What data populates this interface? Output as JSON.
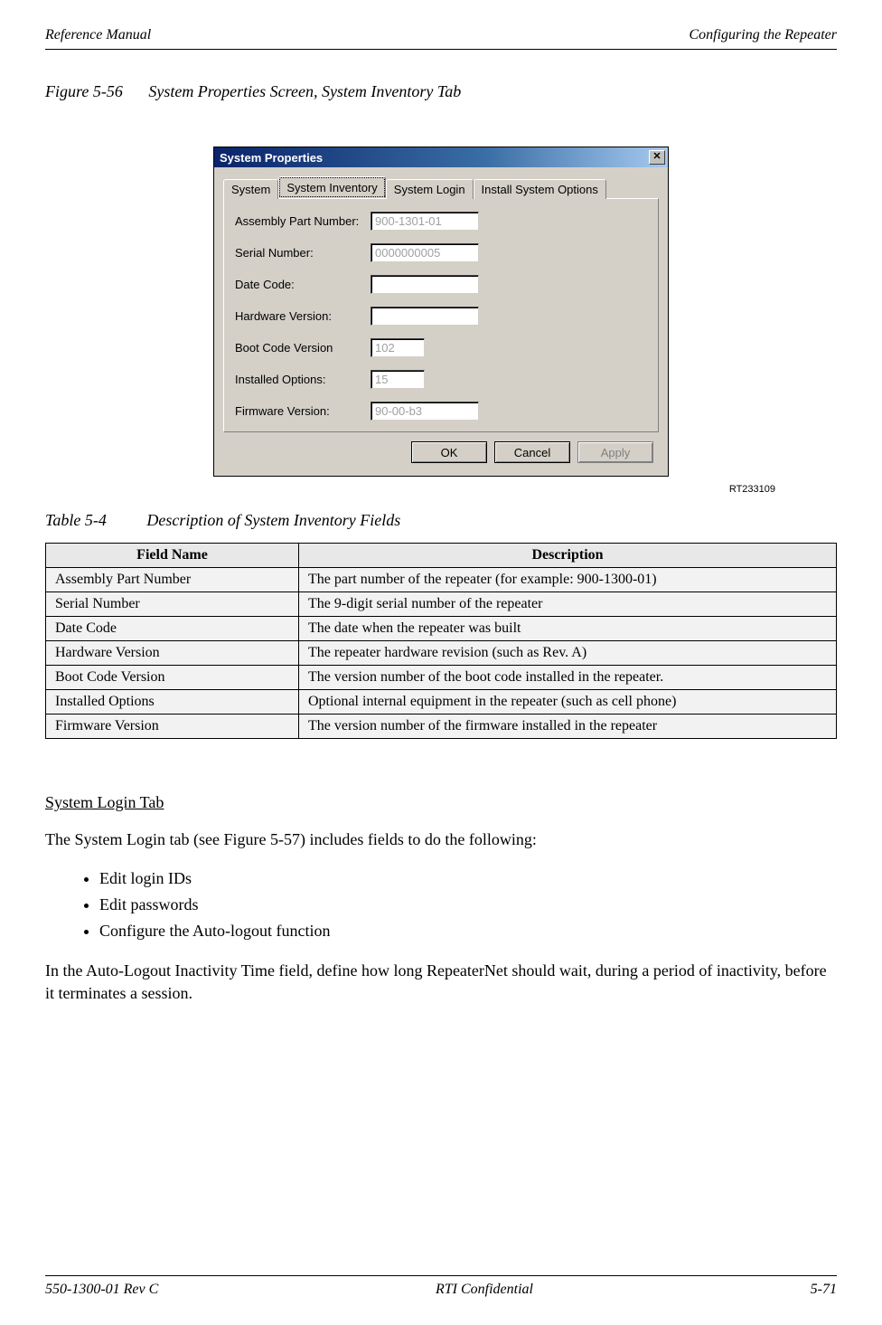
{
  "header": {
    "left": "Reference Manual",
    "right": "Configuring the Repeater"
  },
  "figure": {
    "number": "Figure 5-56",
    "title": "System Properties Screen, System Inventory Tab"
  },
  "dialog": {
    "title": "System Properties",
    "close_glyph": "✕",
    "tabs": [
      "System",
      "System Inventory",
      "System Login",
      "Install System Options"
    ],
    "fields": [
      {
        "label": "Assembly Part Number:",
        "value": "900-1301-01"
      },
      {
        "label": "Serial Number:",
        "value": "0000000005"
      },
      {
        "label": "Date Code:",
        "value": ""
      },
      {
        "label": "Hardware Version:",
        "value": ""
      },
      {
        "label": "Boot Code Version",
        "value": "102"
      },
      {
        "label": "Installed Options:",
        "value": "15"
      },
      {
        "label": "Firmware Version:",
        "value": "90-00-b3"
      }
    ],
    "buttons": {
      "ok": "OK",
      "cancel": "Cancel",
      "apply": "Apply"
    },
    "image_id": "RT233109"
  },
  "table": {
    "number": "Table 5-4",
    "title": "Description of System Inventory Fields",
    "columns": [
      "Field Name",
      "Description"
    ],
    "rows": [
      [
        "Assembly Part Number",
        "The part number of the repeater (for example: 900-1300-01)"
      ],
      [
        "Serial Number",
        "The 9-digit serial number of the repeater"
      ],
      [
        "Date Code",
        "The date when the repeater was built"
      ],
      [
        "Hardware Version",
        "The repeater hardware revision (such as Rev. A)"
      ],
      [
        "Boot Code Version",
        "The version number of the boot code installed in the repeater."
      ],
      [
        "Installed Options",
        " Optional internal equipment in the repeater (such as cell phone)"
      ],
      [
        "Firmware Version",
        "The version number of the firmware installed in the repeater"
      ]
    ]
  },
  "section": {
    "heading": "System Login Tab",
    "intro": "The System Login tab (see Figure 5-57) includes fields to do the following:",
    "bullets": [
      "Edit login IDs",
      "Edit passwords",
      "Configure the Auto-logout function"
    ],
    "para2": "In the Auto-Logout Inactivity Time field, define how long RepeaterNet should wait, during a period of inactivity, before it terminates a session."
  },
  "footer": {
    "left": "550-1300-01 Rev C",
    "center": "RTI Confidential",
    "right": "5-71"
  },
  "chart_data": {
    "type": "table",
    "title": "Description of System Inventory Fields",
    "columns": [
      "Field Name",
      "Description"
    ],
    "rows": [
      [
        "Assembly Part Number",
        "The part number of the repeater (for example: 900-1300-01)"
      ],
      [
        "Serial Number",
        "The 9-digit serial number of the repeater"
      ],
      [
        "Date Code",
        "The date when the repeater was built"
      ],
      [
        "Hardware Version",
        "The repeater hardware revision (such as Rev. A)"
      ],
      [
        "Boot Code Version",
        "The version number of the boot code installed in the repeater."
      ],
      [
        "Installed Options",
        "Optional internal equipment in the repeater (such as cell phone)"
      ],
      [
        "Firmware Version",
        "The version number of the firmware installed in the repeater"
      ]
    ]
  }
}
